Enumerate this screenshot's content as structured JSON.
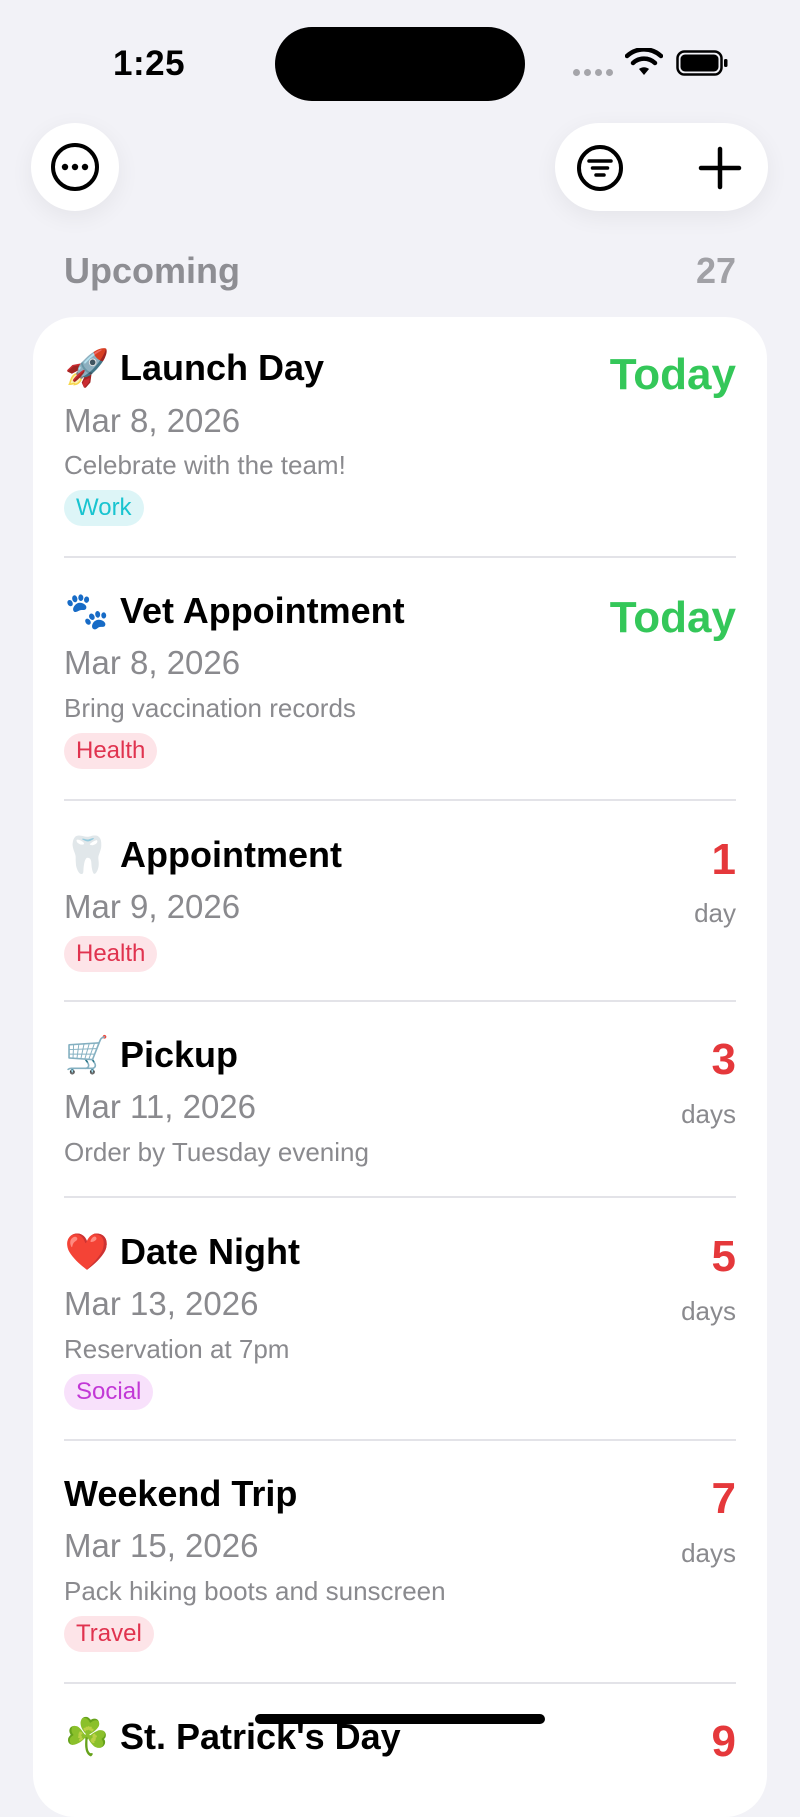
{
  "status_bar": {
    "time": "1:25"
  },
  "toolbar": {
    "more": "more-icon",
    "filter": "filter-icon",
    "add": "plus-icon"
  },
  "section": {
    "title": "Upcoming",
    "count": "27"
  },
  "events": [
    {
      "emoji": "🚀",
      "title": "Launch Day",
      "date": "Mar 8, 2026",
      "note": "Celebrate with the team!",
      "tag": "Work",
      "tag_color": "#19c4d0",
      "tag_bg": "#ddf5f7",
      "countdown": "Today",
      "unit": ""
    },
    {
      "emoji": "🐾",
      "title": "Vet Appointment",
      "date": "Mar 8, 2026",
      "note": "Bring vaccination records",
      "tag": "Health",
      "tag_color": "#e0334f",
      "tag_bg": "#fde4e8",
      "countdown": "Today",
      "unit": ""
    },
    {
      "emoji": "🦷",
      "title": "Appointment",
      "date": "Mar 9, 2026",
      "note": "",
      "tag": "Health",
      "tag_color": "#e0334f",
      "tag_bg": "#fde4e8",
      "countdown": "1",
      "unit": "day"
    },
    {
      "emoji": "🛒",
      "title": "Pickup",
      "date": "Mar 11, 2026",
      "note": "Order by Tuesday evening",
      "tag": "",
      "countdown": "3",
      "unit": "days"
    },
    {
      "emoji": "❤️",
      "title": "Date Night",
      "date": "Mar 13, 2026",
      "note": "Reservation at 7pm",
      "tag": "Social",
      "tag_color": "#c238d6",
      "tag_bg": "#f8e1fb",
      "countdown": "5",
      "unit": "days"
    },
    {
      "emoji": "",
      "title": "Weekend Trip",
      "date": "Mar 15, 2026",
      "note": "Pack hiking boots and sunscreen",
      "tag": "Travel",
      "tag_color": "#e0334f",
      "tag_bg": "#fde4e8",
      "countdown": "7",
      "unit": "days"
    },
    {
      "emoji": "☘️",
      "title": "St. Patrick's Day",
      "date": "",
      "note": "",
      "tag": "",
      "countdown": "9",
      "unit": ""
    }
  ],
  "colors": {
    "today": "#34c759",
    "countdown": "#e5383b",
    "background": "#f2f2f7"
  }
}
